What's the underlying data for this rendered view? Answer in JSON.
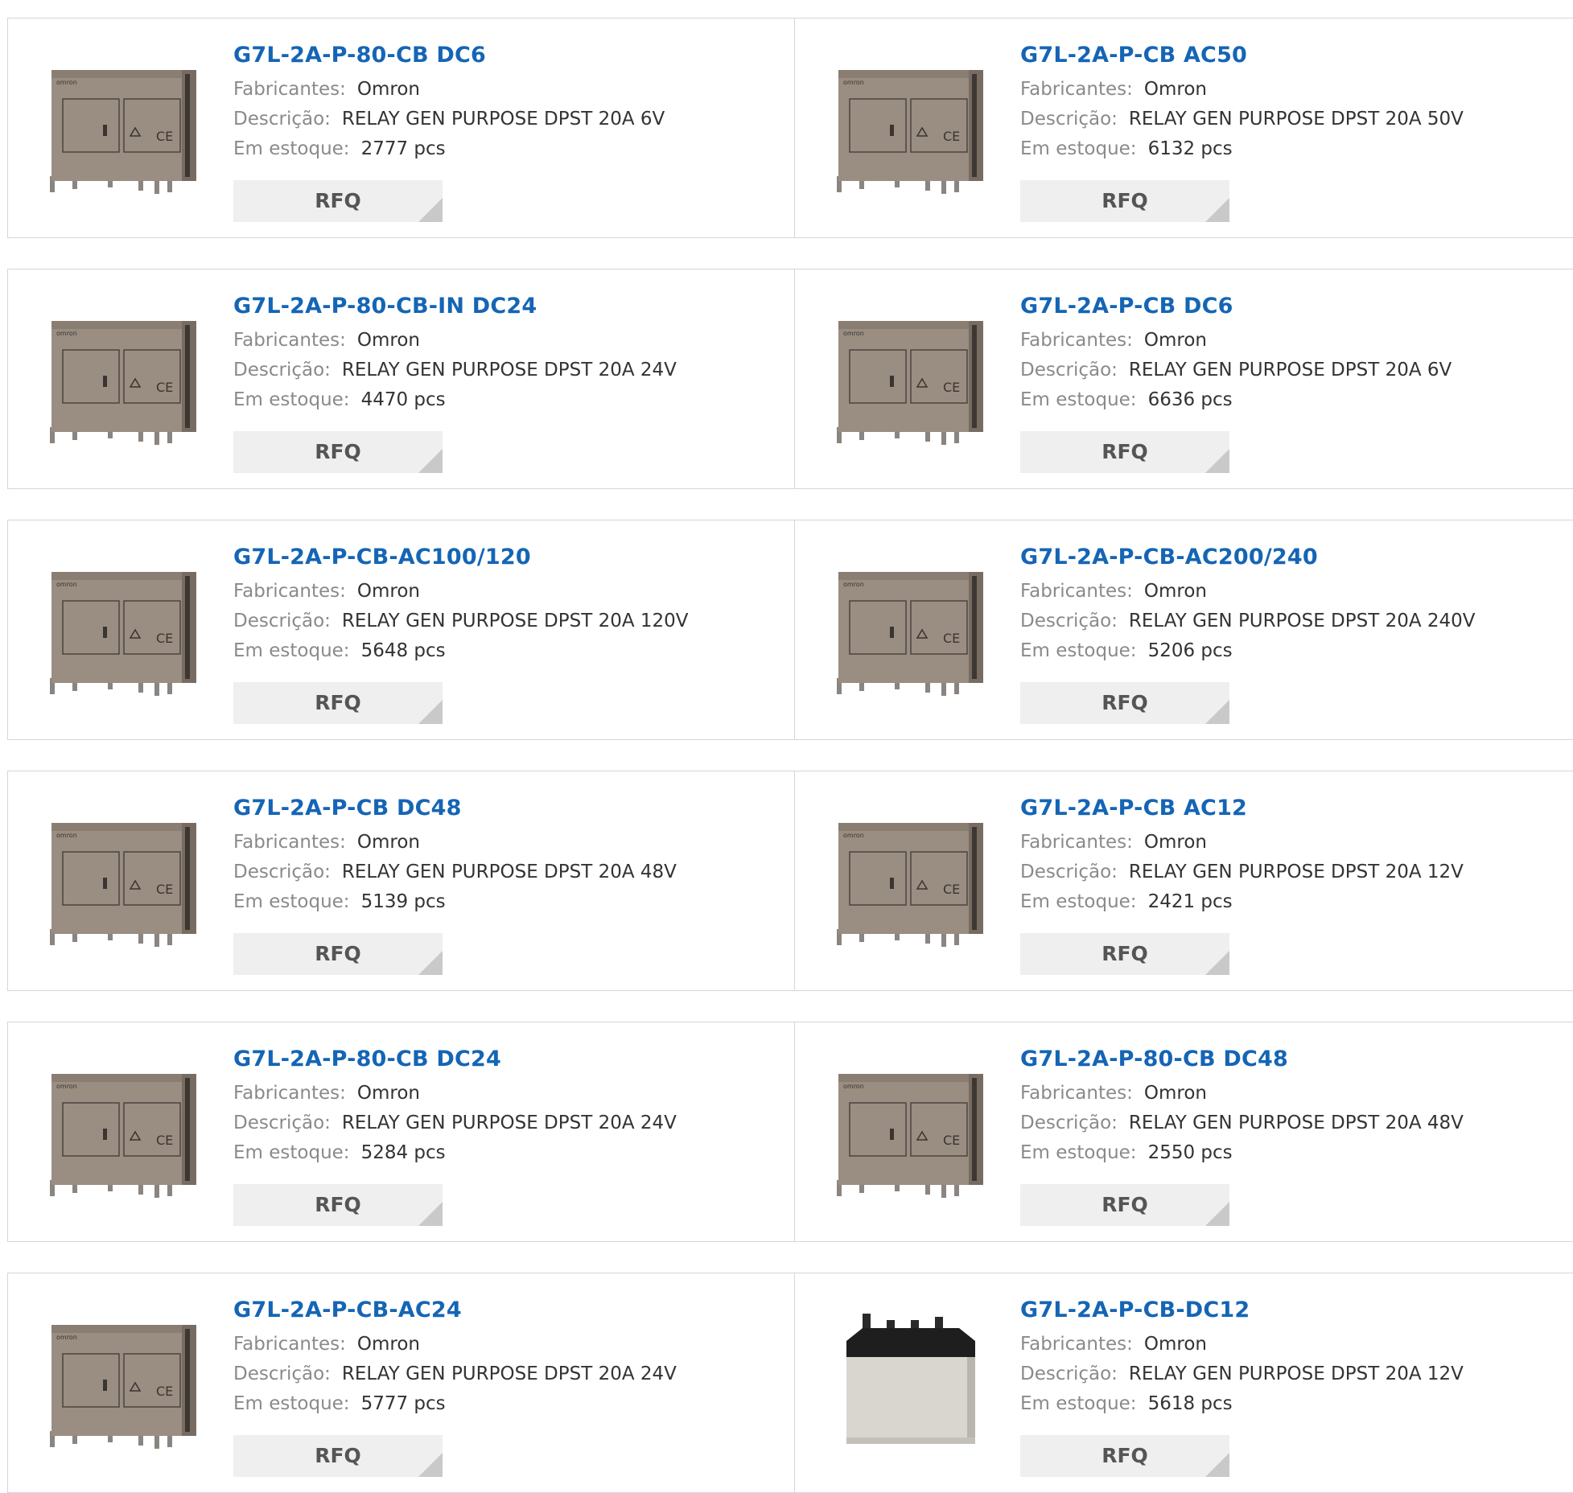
{
  "labels": {
    "manufacturer": "Fabricantes:",
    "description": "Descrição:",
    "stock": "Em estoque:",
    "rfq": "RFQ"
  },
  "colors": {
    "title": "#1565b5",
    "label": "#8a8a8a",
    "button_bg": "#efefef"
  },
  "products": [
    {
      "name": "G7L-2A-P-80-CB DC6",
      "manufacturer": "Omron",
      "description": "RELAY GEN PURPOSE DPST 20A 6V",
      "stock": "2777 pcs",
      "image": "relay-grey-icon"
    },
    {
      "name": "G7L-2A-P-CB AC50",
      "manufacturer": "Omron",
      "description": "RELAY GEN PURPOSE DPST 20A 50V",
      "stock": "6132 pcs",
      "image": "relay-grey-icon"
    },
    {
      "name": "G7L-2A-P-80-CB-IN DC24",
      "manufacturer": "Omron",
      "description": "RELAY GEN PURPOSE DPST 20A 24V",
      "stock": "4470 pcs",
      "image": "relay-grey-icon"
    },
    {
      "name": "G7L-2A-P-CB DC6",
      "manufacturer": "Omron",
      "description": "RELAY GEN PURPOSE DPST 20A 6V",
      "stock": "6636 pcs",
      "image": "relay-grey-icon"
    },
    {
      "name": "G7L-2A-P-CB-AC100/120",
      "manufacturer": "Omron",
      "description": "RELAY GEN PURPOSE DPST 20A 120V",
      "stock": "5648 pcs",
      "image": "relay-grey-icon"
    },
    {
      "name": "G7L-2A-P-CB-AC200/240",
      "manufacturer": "Omron",
      "description": "RELAY GEN PURPOSE DPST 20A 240V",
      "stock": "5206 pcs",
      "image": "relay-grey-icon"
    },
    {
      "name": "G7L-2A-P-CB DC48",
      "manufacturer": "Omron",
      "description": "RELAY GEN PURPOSE DPST 20A 48V",
      "stock": "5139 pcs",
      "image": "relay-grey-icon"
    },
    {
      "name": "G7L-2A-P-CB AC12",
      "manufacturer": "Omron",
      "description": "RELAY GEN PURPOSE DPST 20A 12V",
      "stock": "2421 pcs",
      "image": "relay-grey-icon"
    },
    {
      "name": "G7L-2A-P-80-CB DC24",
      "manufacturer": "Omron",
      "description": "RELAY GEN PURPOSE DPST 20A 24V",
      "stock": "5284 pcs",
      "image": "relay-grey-icon"
    },
    {
      "name": "G7L-2A-P-80-CB DC48",
      "manufacturer": "Omron",
      "description": "RELAY GEN PURPOSE DPST 20A 48V",
      "stock": "2550 pcs",
      "image": "relay-grey-icon"
    },
    {
      "name": "G7L-2A-P-CB-AC24",
      "manufacturer": "Omron",
      "description": "RELAY GEN PURPOSE DPST 20A 24V",
      "stock": "5777 pcs",
      "image": "relay-grey-icon"
    },
    {
      "name": "G7L-2A-P-CB-DC12",
      "manufacturer": "Omron",
      "description": "RELAY GEN PURPOSE DPST 20A 12V",
      "stock": "5618 pcs",
      "image": "relay-white-icon"
    }
  ]
}
